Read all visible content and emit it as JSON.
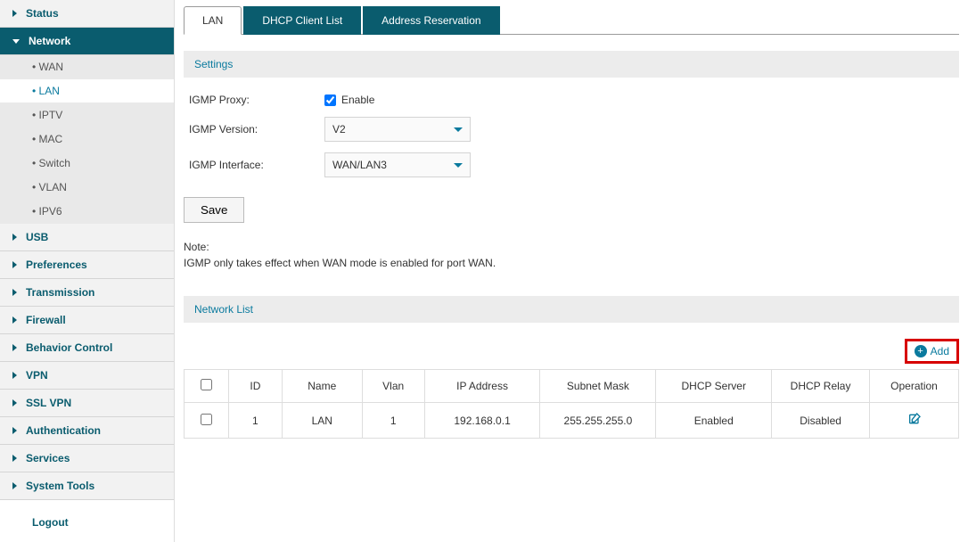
{
  "sidebar": {
    "items": [
      {
        "label": "Status",
        "expanded": false
      },
      {
        "label": "Network",
        "expanded": true,
        "children": [
          {
            "label": "WAN"
          },
          {
            "label": "LAN",
            "active": true
          },
          {
            "label": "IPTV"
          },
          {
            "label": "MAC"
          },
          {
            "label": "Switch"
          },
          {
            "label": "VLAN"
          },
          {
            "label": "IPV6"
          }
        ]
      },
      {
        "label": "USB"
      },
      {
        "label": "Preferences"
      },
      {
        "label": "Transmission"
      },
      {
        "label": "Firewall"
      },
      {
        "label": "Behavior Control"
      },
      {
        "label": "VPN"
      },
      {
        "label": "SSL VPN"
      },
      {
        "label": "Authentication"
      },
      {
        "label": "Services"
      },
      {
        "label": "System Tools"
      }
    ],
    "logout": "Logout"
  },
  "tabs": [
    "LAN",
    "DHCP Client List",
    "Address Reservation"
  ],
  "settings": {
    "header": "Settings",
    "igmp_proxy_label": "IGMP Proxy:",
    "enable_text": "Enable",
    "igmp_version_label": "IGMP Version:",
    "igmp_version_value": "V2",
    "igmp_interface_label": "IGMP Interface:",
    "igmp_interface_value": "WAN/LAN3",
    "save_label": "Save",
    "note_heading": "Note:",
    "note_body": "IGMP only takes effect when WAN mode is enabled for port WAN."
  },
  "network_list": {
    "header": "Network List",
    "add_label": "Add",
    "columns": [
      "",
      "ID",
      "Name",
      "Vlan",
      "IP Address",
      "Subnet Mask",
      "DHCP Server",
      "DHCP Relay",
      "Operation"
    ],
    "rows": [
      {
        "id": "1",
        "name": "LAN",
        "vlan": "1",
        "ip": "192.168.0.1",
        "mask": "255.255.255.0",
        "dhcp_server": "Enabled",
        "dhcp_relay": "Disabled"
      }
    ]
  }
}
